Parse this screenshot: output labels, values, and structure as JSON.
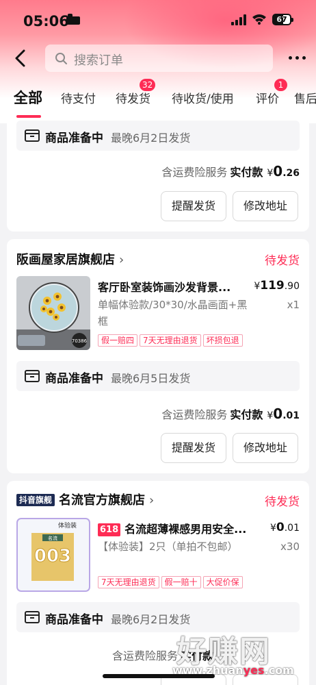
{
  "status": {
    "time": "05:06",
    "battery": "67"
  },
  "search": {
    "placeholder": "搜索订单"
  },
  "tabs": [
    {
      "label": "全部"
    },
    {
      "label": "待支付"
    },
    {
      "label": "待发货",
      "badge": "32"
    },
    {
      "label": "待收货/使用"
    },
    {
      "label": "评价",
      "badge": "1"
    },
    {
      "label": "售后"
    }
  ],
  "order1": {
    "ship_status": "商品准备中",
    "ship_eta": "最晚6月2日发货",
    "insurance": "含运费险服务",
    "paid_label": "实付款",
    "currency": "¥",
    "paid_int": "0",
    "paid_dec": ".26",
    "btn_remind": "提醒发货",
    "btn_address": "修改地址"
  },
  "order2": {
    "shop": "阪画屋家居旗舰店",
    "status": "待发货",
    "title": "客厅卧室装饰画沙发背景...",
    "price_cur": "¥",
    "price_int": "119",
    "price_dec": ".90",
    "spec": "单幅体验款/30*30/水晶画面+黑框",
    "qty": "x1",
    "tags": [
      "假一赔四",
      "7天无理由退货",
      "坏损包退"
    ],
    "thumb_code": "70386",
    "ship_status": "商品准备中",
    "ship_eta": "最晚6月5日发货",
    "insurance": "含运费险服务",
    "paid_label": "实付款",
    "currency": "¥",
    "paid_int": "0",
    "paid_dec": ".01",
    "btn_remind": "提醒发货",
    "btn_address": "修改地址"
  },
  "order3": {
    "flag": "抖音旗舰",
    "shop": "名流官方旗舰店",
    "status": "待发货",
    "promo": "618",
    "title": "名流超薄裸感男用安全...",
    "price_cur": "¥",
    "price_int": "0",
    "price_dec": ".01",
    "spec": "【体验装】2只（单拍不包邮）",
    "qty": "x30",
    "tags": [
      "7天无理由退货",
      "假一赔十",
      "大促价保"
    ],
    "thumb_label": "体验装",
    "thumb_brand": "名流",
    "thumb_big": "003",
    "ship_status": "商品准备中",
    "ship_eta": "最晚6月2日发货",
    "insurance": "含运费险服务",
    "paid_label": "实付款"
  },
  "watermark": {
    "big": "好赚网",
    "url_a": "www.zhuan",
    "url_b": "yes",
    "url_c": ".com"
  },
  "colors": {
    "accent": "#fe2c55",
    "bg": "#f3f3f5",
    "card": "#ffffff"
  }
}
